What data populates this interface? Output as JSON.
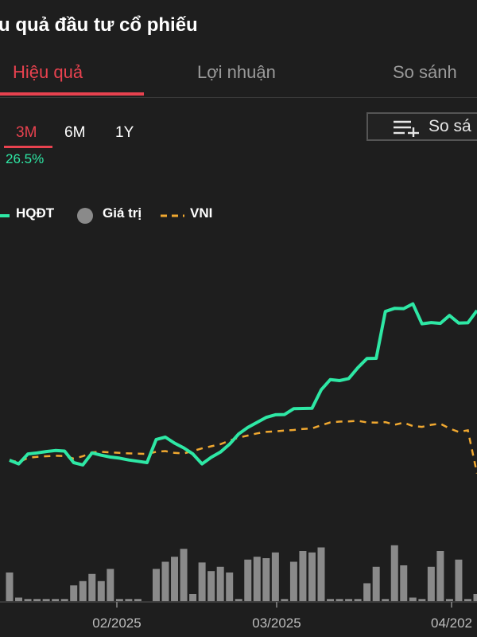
{
  "header": {
    "title": "u quả đầu tư cổ phiếu"
  },
  "tabs": [
    {
      "label": "Hiệu quả",
      "active": true
    },
    {
      "label": "Lợi nhuận",
      "active": false
    },
    {
      "label": "So sánh",
      "active": false
    }
  ],
  "periods": [
    {
      "label": "3M",
      "active": true
    },
    {
      "label": "6M",
      "active": false
    },
    {
      "label": "1Y",
      "active": false
    }
  ],
  "performance": {
    "value": "26.5%"
  },
  "compare_button": {
    "label": "So sá",
    "icon": "list-add-icon"
  },
  "legend": [
    {
      "label": "HQĐT",
      "style": "solid",
      "color": "#2ee8a5"
    },
    {
      "label": "Giá trị",
      "style": "dot",
      "color": "#8a8a8a"
    },
    {
      "label": "VNI",
      "style": "dashed",
      "color": "#f0a830"
    }
  ],
  "colors": {
    "accent": "#e8424f",
    "positive": "#2ee8a5",
    "vni": "#f0a830",
    "volume": "#8a8a8a",
    "background": "#1e1e1e"
  },
  "chart_data": {
    "type": "line",
    "x_tick_labels": [
      "02/2025",
      "03/2025",
      "04/202"
    ],
    "series": [
      {
        "name": "HQĐT",
        "y": [
          0.0,
          -1.4,
          2.4,
          2.8,
          3.3,
          3.7,
          3.5,
          -0.9,
          -1.8,
          2.8,
          1.9,
          1.2,
          0.8,
          0.1,
          -0.4,
          -0.9,
          7.9,
          8.8,
          6.5,
          4.7,
          2.4,
          -1.4,
          1.1,
          3.1,
          6.1,
          10.0,
          12.5,
          14.4,
          16.3,
          17.3,
          17.4,
          19.6,
          19.7,
          19.8,
          26.8,
          30.7,
          30.3,
          31.1,
          35.2,
          38.7,
          38.8,
          56.6,
          57.8,
          57.7,
          59.5,
          51.9,
          52.4,
          52.1,
          55.1,
          52.2,
          52.3,
          57.0
        ]
      },
      {
        "name": "VNI",
        "y": [
          0.0,
          -0.8,
          0.9,
          1.3,
          1.5,
          1.7,
          1.6,
          0.6,
          1.5,
          3.0,
          3.2,
          3.0,
          2.8,
          2.6,
          2.5,
          2.4,
          3.2,
          3.5,
          2.8,
          2.6,
          3.5,
          4.5,
          5.3,
          6.1,
          7.5,
          8.6,
          9.4,
          10.2,
          10.8,
          11.0,
          11.3,
          11.5,
          11.9,
          12.1,
          13.3,
          14.4,
          14.7,
          14.8,
          15.0,
          14.4,
          14.3,
          14.5,
          13.5,
          14.3,
          13.0,
          12.7,
          13.5,
          13.9,
          12.1,
          10.8,
          11.4,
          -5.0
        ]
      },
      {
        "name": "Giá trị",
        "y": [
          40,
          5,
          3,
          3,
          3,
          3,
          3,
          22,
          28,
          38,
          28,
          45,
          3,
          3,
          3,
          0,
          45,
          55,
          62,
          73,
          10,
          54,
          42,
          48,
          40,
          3,
          58,
          62,
          60,
          68,
          3,
          55,
          70,
          68,
          75,
          3,
          3,
          3,
          3,
          25,
          48,
          3,
          78,
          50,
          5,
          3,
          48,
          70,
          3,
          58,
          3,
          10
        ]
      }
    ]
  }
}
